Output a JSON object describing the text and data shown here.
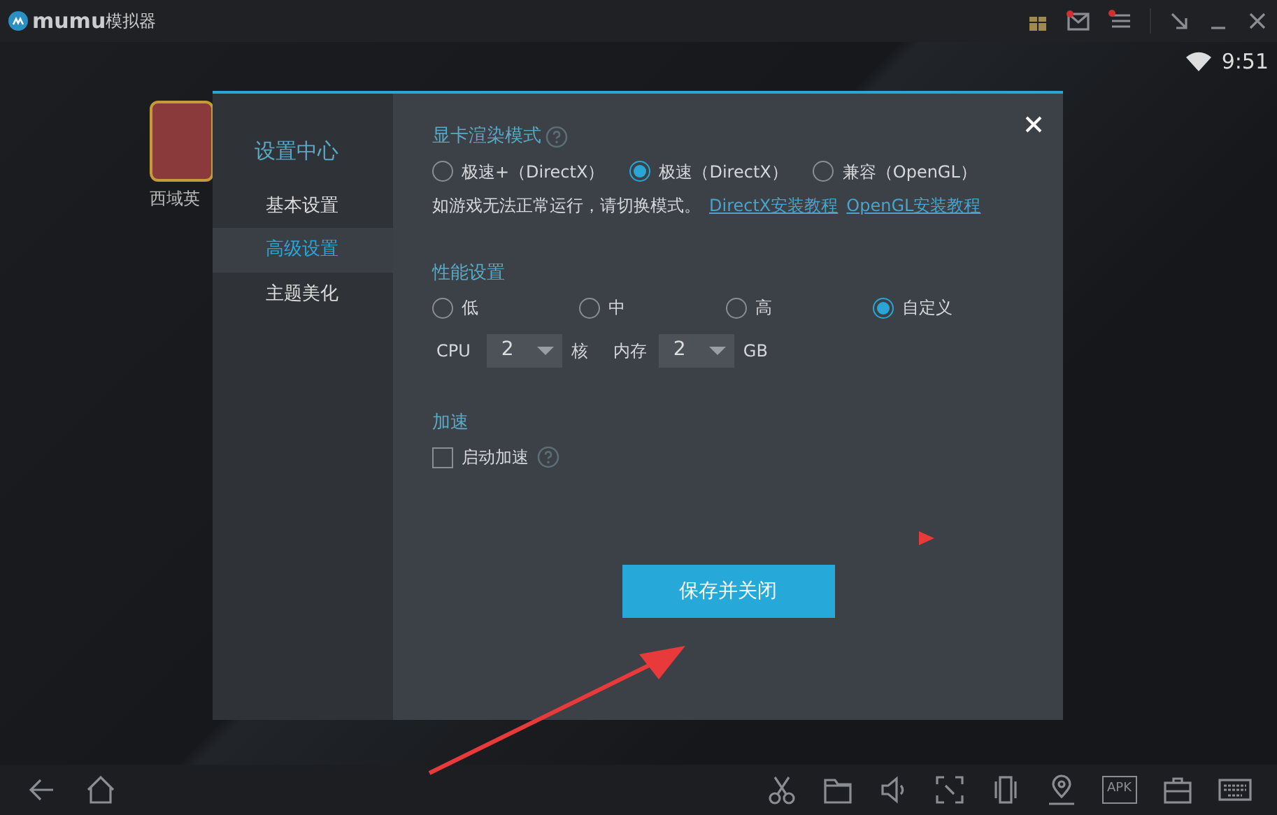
{
  "title_bar": {
    "logo_text": "mumu",
    "title": "模拟器"
  },
  "status_bar": {
    "time": "9:51"
  },
  "desktop_apps": [
    {
      "label": "西域英"
    }
  ],
  "dialog": {
    "sidebar": {
      "title": "设置中心",
      "items": [
        {
          "label": "基本设置",
          "selected": false
        },
        {
          "label": "高级设置",
          "selected": true
        },
        {
          "label": "主题美化",
          "selected": false
        }
      ]
    },
    "render_mode": {
      "title": "显卡渲染模式",
      "options": [
        {
          "label": "极速+（DirectX）",
          "selected": false
        },
        {
          "label": "极速（DirectX）",
          "selected": true
        },
        {
          "label": "兼容（OpenGL）",
          "selected": false
        }
      ],
      "note": "如游戏无法正常运行，请切换模式。",
      "links": [
        "DirectX安装教程",
        "OpenGL安装教程"
      ]
    },
    "performance": {
      "title": "性能设置",
      "options": [
        {
          "label": "低",
          "selected": false
        },
        {
          "label": "中",
          "selected": false
        },
        {
          "label": "高",
          "selected": false
        },
        {
          "label": "自定义",
          "selected": true
        }
      ],
      "cpu_label": "CPU",
      "cpu_value": "2",
      "cpu_unit": "核",
      "memory_label": "内存",
      "memory_value": "2",
      "memory_unit": "GB"
    },
    "acceleration": {
      "title": "加速",
      "checkbox": {
        "label": "启动加速",
        "checked": false
      }
    },
    "save_button": "保存并关闭"
  },
  "nav_bar": {
    "apk_label": "APK"
  }
}
